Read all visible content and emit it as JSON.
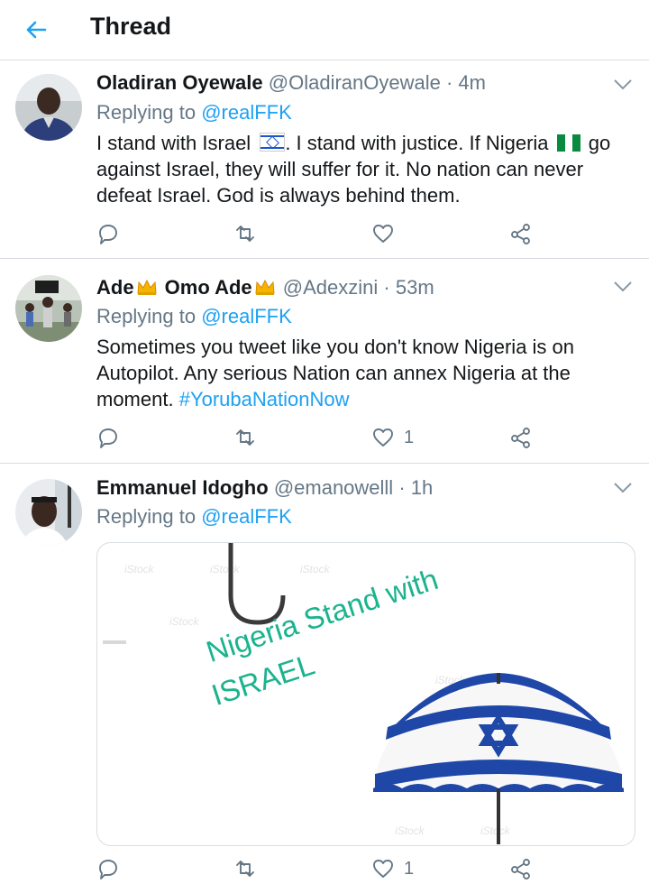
{
  "header": {
    "title": "Thread"
  },
  "tweets": [
    {
      "name": "Oladiran Oyewale",
      "handle": "@OladiranOyewale",
      "time": "· 4m",
      "reply_prefix": "Replying to ",
      "reply_to": "@realFFK",
      "text_1": "I stand with Israel ",
      "text_2": ". I stand with justice. If Nigeria ",
      "text_3": " go against Israel, they will suffer for it. No nation can never defeat Israel. God is always behind them.",
      "likes": ""
    },
    {
      "name_1": "Ade",
      "name_2": " Omo Ade",
      "handle": "@Adexzini",
      "time": "· 53m",
      "reply_prefix": "Replying to ",
      "reply_to": "@realFFK",
      "text": "Sometimes you tweet like you don't know Nigeria is on Autopilot. Any serious Nation can annex Nigeria at the moment. ",
      "hashtag": "#YorubaNationNow",
      "likes": "1"
    },
    {
      "name": "Emmanuel Idogho",
      "handle": "@emanowelll",
      "time": "· 1h",
      "reply_prefix": "Replying to ",
      "reply_to": "@realFFK",
      "likes": "1",
      "image": {
        "line1": "Nigeria Stand with",
        "line2": "ISRAEL",
        "watermark": "iStock"
      }
    }
  ],
  "colors": {
    "accent": "#1da1f2",
    "muted": "#657786",
    "text": "#14171a",
    "image_text": "#1bb38e"
  },
  "icons": [
    "back-arrow-icon",
    "chevron-down-icon",
    "reply-icon",
    "retweet-icon",
    "like-icon",
    "share-icon"
  ]
}
